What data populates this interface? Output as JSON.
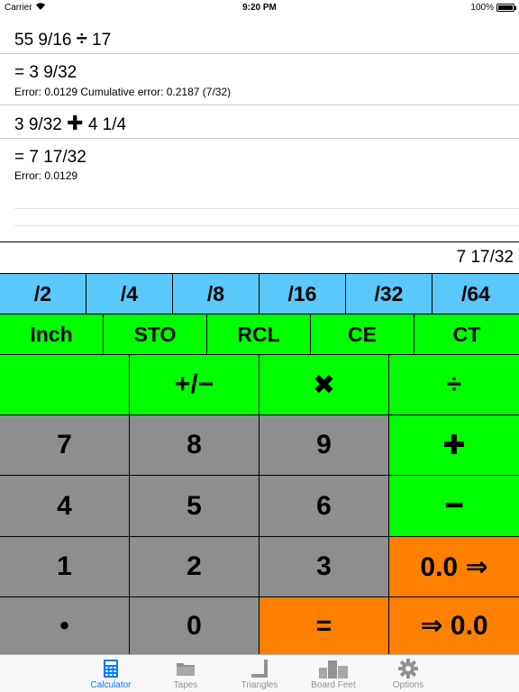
{
  "status_bar": {
    "carrier": "Carrier",
    "time": "9:20 PM",
    "battery": "100%"
  },
  "tape": [
    {
      "expr_left": "55 9/16",
      "op": "÷",
      "expr_right": "17"
    },
    {
      "result": "= 3 9/32",
      "error": "Error: 0.0129  Cumulative error: 0.2187 (7/32)"
    },
    {
      "expr_left": "3 9/32",
      "op": "✚",
      "expr_right": "4 1/4"
    },
    {
      "result": "= 7 17/32",
      "error": "Error: 0.0129"
    }
  ],
  "display": {
    "value": "7 17/32"
  },
  "keypad": {
    "fractions": [
      "/2",
      "/4",
      "/8",
      "/16",
      "/32",
      "/64"
    ],
    "memory": [
      "Inch",
      "STO",
      "RCL",
      "CE",
      "CT"
    ],
    "row_ops": [
      "",
      "+/−",
      "✖",
      "÷"
    ],
    "digits": {
      "seven": "7",
      "eight": "8",
      "nine": "9",
      "four": "4",
      "five": "5",
      "six": "6",
      "one": "1",
      "two": "2",
      "three": "3",
      "dot": "•",
      "zero": "0"
    },
    "plus": "✚",
    "minus": "━",
    "to_decimal": "0.0 ⇒",
    "equals": "=",
    "from_decimal": "⇒ 0.0"
  },
  "tabbar": {
    "tabs": [
      {
        "label": "Calculator",
        "icon": "calculator-icon",
        "active": true
      },
      {
        "label": "Tapes",
        "icon": "folder-icon",
        "active": false
      },
      {
        "label": "Triangles",
        "icon": "triangle-ruler-icon",
        "active": false
      },
      {
        "label": "Board Feet",
        "icon": "boards-icon",
        "active": false
      },
      {
        "label": "Options",
        "icon": "gear-icon",
        "active": false
      }
    ]
  },
  "colors": {
    "blue_key": "#5ac8fa",
    "green_key": "#00ff00",
    "gray_key": "#8e8e8e",
    "orange_key": "#ff8000",
    "active_tab": "#007aff"
  }
}
